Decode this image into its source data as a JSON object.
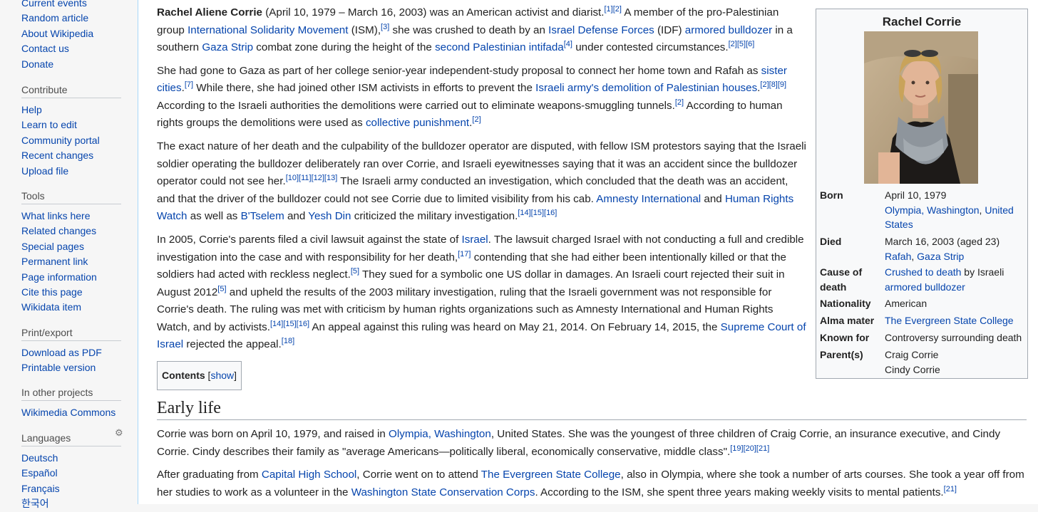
{
  "sidebar": {
    "top_items": [
      "Current events",
      "Random article",
      "About Wikipedia",
      "Contact us",
      "Donate"
    ],
    "contribute": {
      "heading": "Contribute",
      "items": [
        "Help",
        "Learn to edit",
        "Community portal",
        "Recent changes",
        "Upload file"
      ]
    },
    "tools": {
      "heading": "Tools",
      "items": [
        "What links here",
        "Related changes",
        "Special pages",
        "Permanent link",
        "Page information",
        "Cite this page",
        "Wikidata item"
      ]
    },
    "print": {
      "heading": "Print/export",
      "items": [
        "Download as PDF",
        "Printable version"
      ]
    },
    "projects": {
      "heading": "In other projects",
      "items": [
        "Wikimedia Commons"
      ]
    },
    "languages": {
      "heading": "Languages",
      "items": [
        "Deutsch",
        "Español",
        "Français",
        "한국어"
      ]
    }
  },
  "article": {
    "p1": [
      "Rachel Aliene Corrie",
      " (April 10, 1979 – March 16, 2003) was an American activist and diarist.",
      "[1][2]",
      " A member of the pro-Palestinian group ",
      "International Solidarity Movement",
      " (ISM),",
      "[3]",
      " she was crushed to death by an ",
      "Israel Defense Forces",
      " (IDF) ",
      "armored bulldozer",
      " in a southern ",
      "Gaza Strip",
      " combat zone during the height of the ",
      "second Palestinian intifada",
      "[4]",
      " under contested circumstances.",
      "[2][5][6]"
    ],
    "p2": [
      "She had gone to Gaza as part of her college senior-year independent-study proposal to connect her home town and Rafah as ",
      "sister cities",
      ".",
      "[7]",
      " While there, she had joined other ISM activists in efforts to prevent the ",
      "Israeli army's demolition of Palestinian houses",
      ".",
      "[2][8][9]",
      " According to the Israeli authorities the demolitions were carried out to eliminate weapons-smuggling tunnels.",
      "[2]",
      " According to human rights groups the demolitions were used as ",
      "collective punishment",
      ".",
      "[2]"
    ],
    "p3": [
      "The exact nature of her death and the culpability of the bulldozer operator are disputed, with fellow ISM protestors saying that the Israeli soldier operating the bulldozer deliberately ran over Corrie, and Israeli eyewitnesses saying that it was an accident since the bulldozer operator could not see her.",
      "[10][11][12][13]",
      " The Israeli army conducted an investigation, which concluded that the death was an accident, and that the driver of the bulldozer could not see Corrie due to limited visibility from his cab. ",
      "Amnesty International",
      " and ",
      "Human Rights Watch",
      " as well as ",
      "B'Tselem",
      " and ",
      "Yesh Din",
      " criticized the military investigation.",
      "[14][15][16]"
    ],
    "p4": [
      "In 2005, Corrie's parents filed a civil lawsuit against the state of ",
      "Israel",
      ". The lawsuit charged Israel with not conducting a full and credible investigation into the case and with responsibility for her death,",
      "[17]",
      " contending that she had either been intentionally killed or that the soldiers had acted with reckless neglect.",
      "[5]",
      " They sued for a symbolic one US dollar in damages. An Israeli court rejected their suit in August 2012",
      "[5]",
      " and upheld the results of the 2003 military investigation, ruling that the Israeli government was not responsible for Corrie's death. The ruling was met with criticism by human rights organizations such as Amnesty International and Human Rights Watch, and by activists.",
      "[14][15][16]",
      " An appeal against this ruling was heard on May 21, 2014. On February 14, 2015, the ",
      "Supreme Court of Israel",
      " rejected the appeal.",
      "[18]"
    ],
    "toc_label": "Contents",
    "toc_show": "show",
    "section_title": "Early life",
    "p5": [
      "Corrie was born on April 10, 1979, and raised in ",
      "Olympia, Washington",
      ", United States. She was the youngest of three children of Craig Corrie, an insurance executive, and Cindy Corrie. Cindy describes their family as \"average Americans—politically liberal, economically conservative, middle class\".",
      "[19][20][21]"
    ],
    "p6": [
      "After graduating from ",
      "Capital High School",
      ", Corrie went on to attend ",
      "The Evergreen State College",
      ", also in Olympia, where she took a number of arts courses. She took a year off from her studies to work as a volunteer in the ",
      "Washington State Conservation Corps",
      ". According to the ISM, she spent three years making weekly visits to mental patients.",
      "[21]"
    ]
  },
  "infobox": {
    "title": "Rachel Corrie",
    "born_label": "Born",
    "born_date": "April 10, 1979",
    "born_place_1": "Olympia, Washington",
    "born_place_sep": ", ",
    "born_place_2": "United States",
    "died_label": "Died",
    "died_date": "March 16, 2003 (aged 23)",
    "died_place_1": "Rafah",
    "died_place_sep": ", ",
    "died_place_2": "Gaza Strip",
    "cause_label": "Cause of death",
    "cause_link1": "Crushed to death",
    "cause_mid": " by Israeli ",
    "cause_link2": "armored bulldozer",
    "nationality_label": "Nationality",
    "nationality": "American",
    "alma_label": "Alma mater",
    "alma": "The Evergreen State College",
    "known_label": "Known for",
    "known": "Controversy surrounding death",
    "parents_label": "Parent(s)",
    "parent1": "Craig Corrie",
    "parent2": "Cindy Corrie"
  },
  "colors": {
    "link": "#0645ad",
    "border": "#a2a9b1",
    "sidebar_bg": "#f6f6f6"
  },
  "icons": {
    "language_settings": "gear-icon"
  }
}
